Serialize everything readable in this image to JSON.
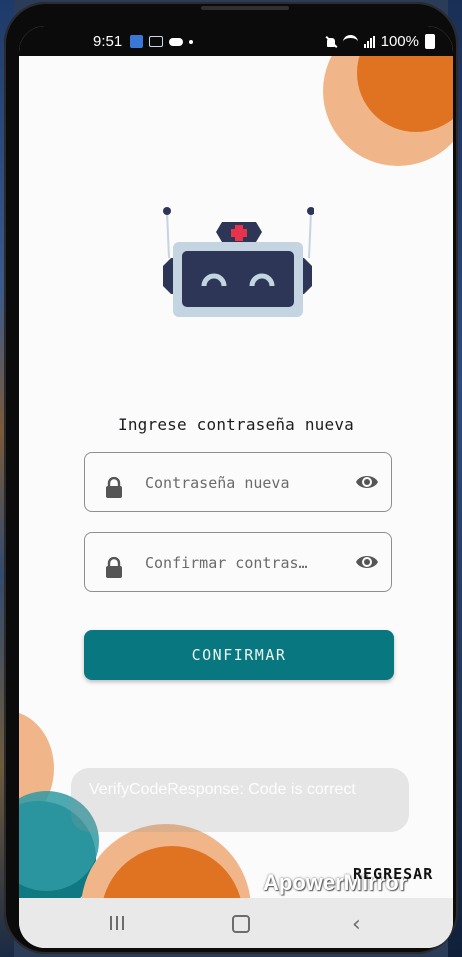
{
  "status_bar": {
    "time": "9:51",
    "battery": "100%",
    "icons": [
      "gallery-icon",
      "voicemail-icon",
      "cloud-icon",
      "dot-icon",
      "mute-icon",
      "wifi-icon",
      "signal-icon",
      "battery-icon"
    ]
  },
  "screen": {
    "title": "Ingrese contraseña nueva",
    "fields": [
      {
        "placeholder": "Contraseña nueva",
        "value": "",
        "lead_icon": "lock-icon",
        "trail_icon": "eye-icon"
      },
      {
        "placeholder": "Confirmar contras…",
        "value": "",
        "lead_icon": "lock-icon",
        "trail_icon": "eye-icon"
      }
    ],
    "confirm_label": "CONFIRMAR",
    "back_label": "REGRESAR"
  },
  "toast": {
    "message": "VerifyCodeResponse: Code is correct"
  },
  "watermark": "ApowerMirror",
  "nav_bar": {
    "buttons": [
      "recent-apps-icon",
      "home-icon",
      "back-icon"
    ]
  },
  "colors": {
    "primary": "#08777f",
    "accent_orange": "#e07322",
    "accent_peach": "#f0b68a",
    "robot_body": "#2d3656",
    "robot_frame": "#c4d4e0",
    "robot_cross": "#e8334a"
  }
}
